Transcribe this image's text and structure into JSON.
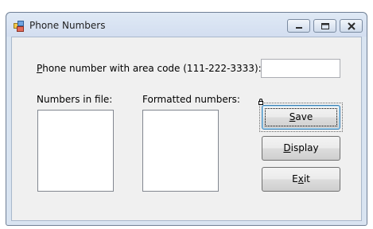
{
  "window": {
    "title": "Phone Numbers",
    "app_icon": "form-icon",
    "controls": [
      "minimize-icon",
      "maximize-icon",
      "close-icon"
    ]
  },
  "form": {
    "phone_label": {
      "mnemonic": "P",
      "rest": "hone number with area code (111-222-3333):"
    },
    "phone_input": {
      "value": "",
      "placeholder": ""
    },
    "numbers_in_file_label": "Numbers in file:",
    "formatted_numbers_label": "Formatted numbers:",
    "numbers_in_file_items": [],
    "formatted_numbers_items": []
  },
  "buttons": {
    "save": {
      "mnemonic": "S",
      "rest": "ave"
    },
    "display": {
      "mnemonic": "D",
      "rest": "isplay"
    },
    "exit": {
      "pre": "E",
      "mnemonic": "x",
      "rest": "it"
    }
  },
  "colors": {
    "window_frame": "#d9e4f1",
    "client_background": "#f0f0f0",
    "focus_border": "#3c7fb1"
  }
}
